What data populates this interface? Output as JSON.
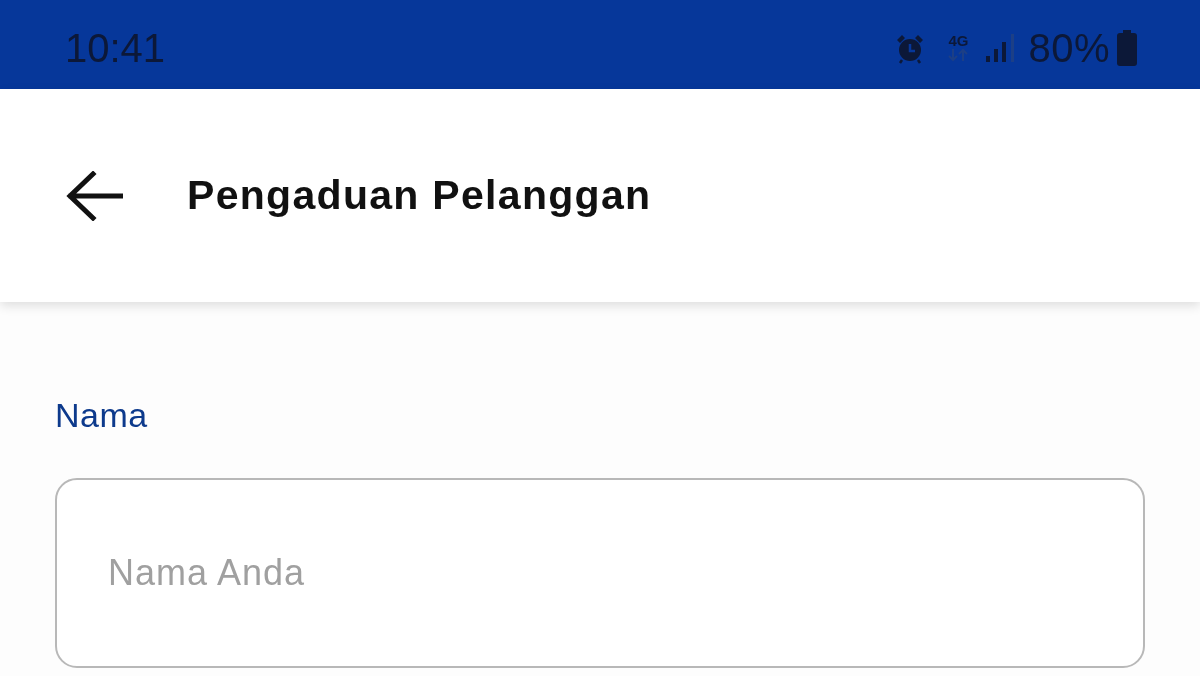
{
  "status_bar": {
    "time": "10:41",
    "network_type": "4G",
    "battery": "80%"
  },
  "app_bar": {
    "title": "Pengaduan Pelanggan"
  },
  "form": {
    "fields": [
      {
        "label": "Nama",
        "placeholder": "Nama Anda"
      }
    ]
  }
}
